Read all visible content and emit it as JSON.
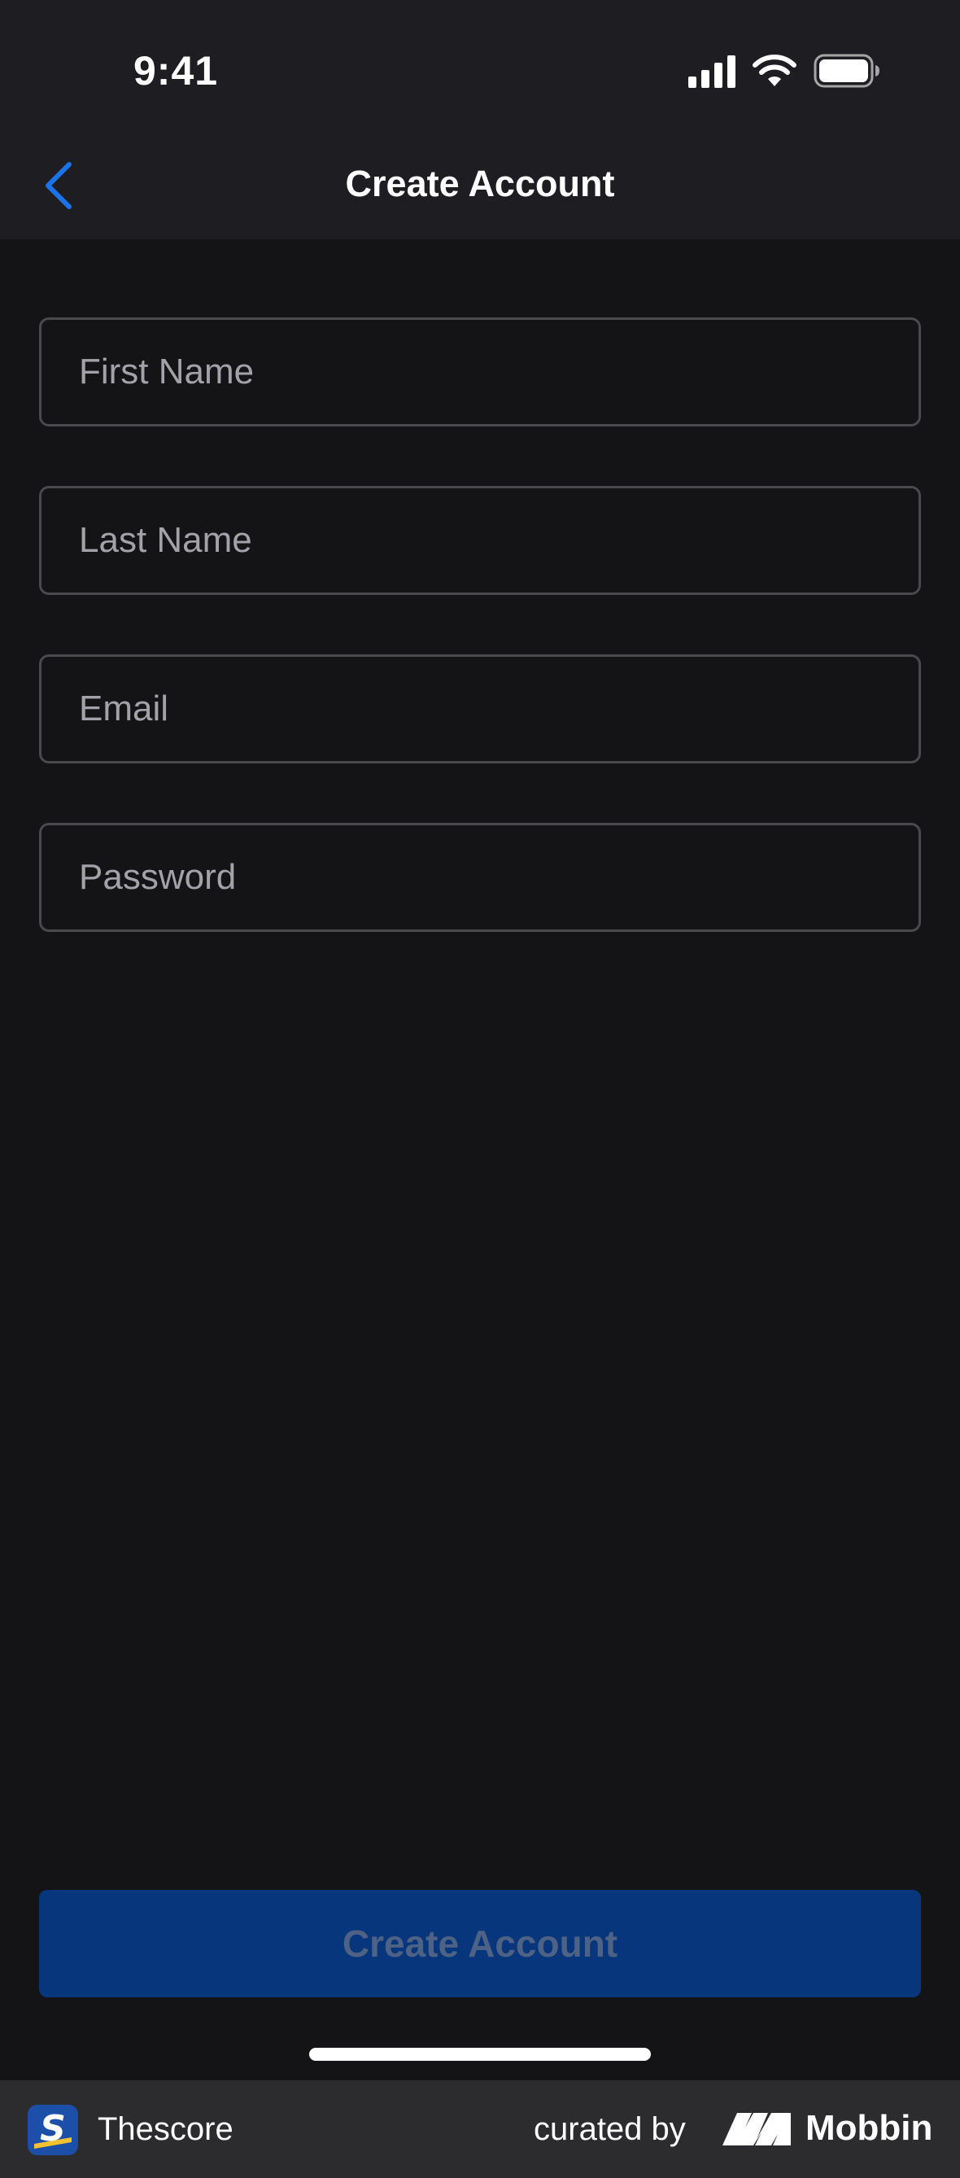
{
  "status_bar": {
    "time": "9:41"
  },
  "nav": {
    "title": "Create Account",
    "back_icon": "chevron-left-icon",
    "accent_color": "#1a73e8"
  },
  "form": {
    "first_name": {
      "placeholder": "First Name",
      "value": ""
    },
    "last_name": {
      "placeholder": "Last Name",
      "value": ""
    },
    "email": {
      "placeholder": "Email",
      "value": ""
    },
    "password": {
      "placeholder": "Password",
      "value": ""
    }
  },
  "actions": {
    "create_label": "Create Account",
    "button_color": "#07367d",
    "disabled": true
  },
  "footer": {
    "app_name": "Thescore",
    "curated_by": "curated by",
    "brand": "Mobbin"
  }
}
